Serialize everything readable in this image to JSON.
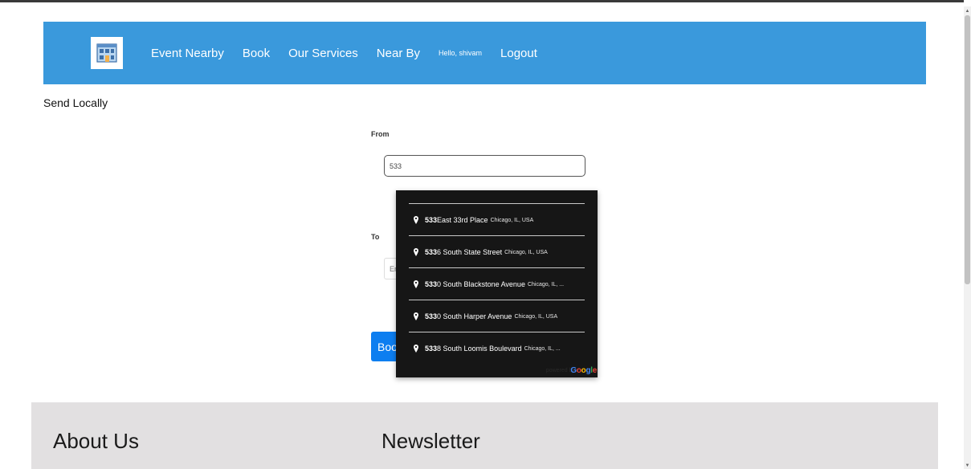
{
  "nav": {
    "links": [
      "Event Nearby",
      "Book",
      "Our Services",
      "Near By"
    ],
    "greeting": "Hello, shivam",
    "logout": "Logout"
  },
  "page": {
    "title": "Send Locally"
  },
  "form": {
    "from_label": "From",
    "from_value": "533",
    "to_label": "To",
    "to_placeholder": "En",
    "book_label": "Book"
  },
  "autocomplete": {
    "suggestions": [
      {
        "match": "533",
        "rest": " East 33rd Place",
        "secondary": "Chicago, IL, USA"
      },
      {
        "match": "533",
        "rest": "6 South State Street",
        "secondary": "Chicago, IL, USA"
      },
      {
        "match": "533",
        "rest": "0 South Blackstone Avenue",
        "secondary": "Chicago, IL, ..."
      },
      {
        "match": "533",
        "rest": "0 South Harper Avenue",
        "secondary": "Chicago, IL, USA"
      },
      {
        "match": "533",
        "rest": "8 South Loomis Boulevard",
        "secondary": "Chicago, IL, ..."
      }
    ],
    "powered_by": "powered by",
    "google": "Google"
  },
  "footer": {
    "about_heading": "About Us",
    "newsletter_heading": "Newsletter"
  },
  "colors": {
    "navbar": "#3a99dc",
    "button": "#0d7ef0",
    "dropdown": "#161616",
    "footer": "#e2e0e1"
  },
  "icons": {
    "logo": "building-icon",
    "pin": "map-pin-icon"
  }
}
